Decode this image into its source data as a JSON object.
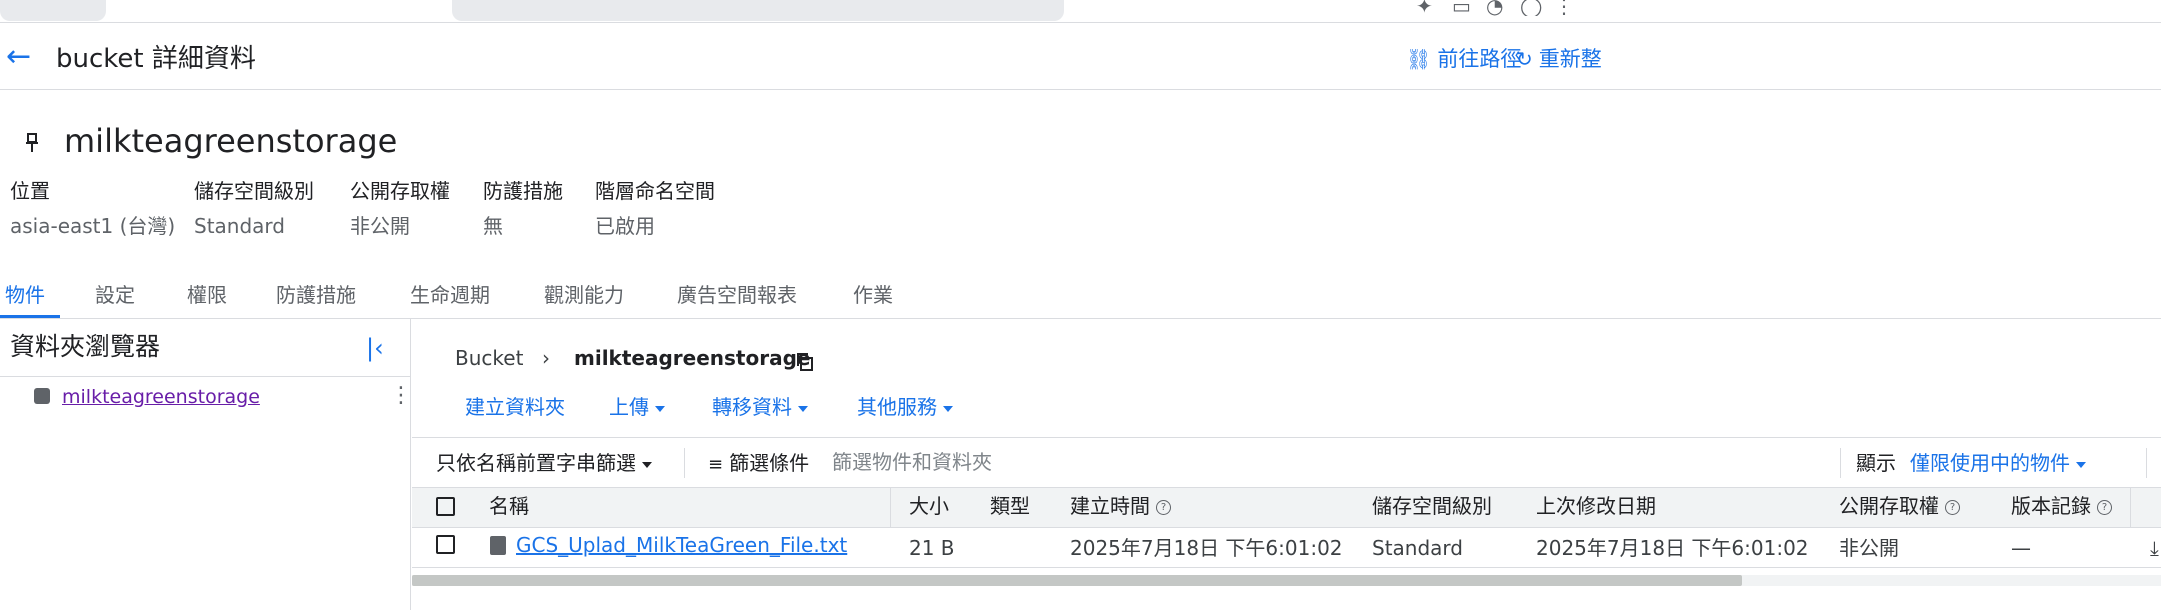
{
  "header": {
    "title": "bucket 詳細資料",
    "go_to_path": "前往路徑",
    "refresh": "重新整"
  },
  "bucket": {
    "name": "milkteagreenstorage",
    "meta": [
      {
        "label": "位置",
        "value": "asia-east1 (台灣)"
      },
      {
        "label": "儲存空間級別",
        "value": "Standard"
      },
      {
        "label": "公開存取權",
        "value": "非公開"
      },
      {
        "label": "防護措施",
        "value": "無"
      },
      {
        "label": "階層命名空間",
        "value": "已啟用"
      }
    ]
  },
  "tabs": [
    {
      "label": "物件",
      "active": true
    },
    {
      "label": "設定"
    },
    {
      "label": "權限"
    },
    {
      "label": "防護措施"
    },
    {
      "label": "生命週期"
    },
    {
      "label": "觀測能力"
    },
    {
      "label": "廣告空間報表"
    },
    {
      "label": "作業"
    }
  ],
  "folder_browser": {
    "title": "資料夾瀏覽器",
    "items": [
      "milkteagreenstorage"
    ]
  },
  "breadcrumb": {
    "root": "Bucket",
    "current": "milkteagreenstorage"
  },
  "toolbar": {
    "create_folder": "建立資料夾",
    "upload": "上傳",
    "transfer": "轉移資料",
    "other_services": "其他服務"
  },
  "filter": {
    "prefix_mode": "只依名稱前置字串篩選",
    "filter_label": "篩選條件",
    "placeholder": "篩選物件和資料夾",
    "show_label": "顯示",
    "show_value": "僅限使用中的物件"
  },
  "table": {
    "columns": [
      "名稱",
      "大小",
      "類型",
      "建立時間",
      "儲存空間級別",
      "上次修改日期",
      "公開存取權",
      "版本記錄"
    ],
    "rows": [
      {
        "name": "GCS_Uplad_MilkTeaGreen_File.txt",
        "size": "21 B",
        "type": "",
        "created": "2025年7月18日 下午6:01:02",
        "storage_class": "Standard",
        "modified": "2025年7月18日 下午6:01:02",
        "public_access": "非公開",
        "version": "—"
      }
    ]
  },
  "icons": {
    "back": "arrow-back-icon",
    "link": "link-icon",
    "refresh": "refresh-icon",
    "pin": "pin-icon",
    "collapse": "collapse-left-icon",
    "bucket": "bucket-icon",
    "more": "more-vert-icon",
    "copy": "copy-icon",
    "filter": "filter-list-icon",
    "help": "help-icon",
    "file": "file-icon",
    "download": "download-icon"
  },
  "colors": {
    "accent": "#1a73e8",
    "visited_link": "#681da8",
    "header_bg": "#f1f3f4",
    "divider": "#dadce0"
  }
}
